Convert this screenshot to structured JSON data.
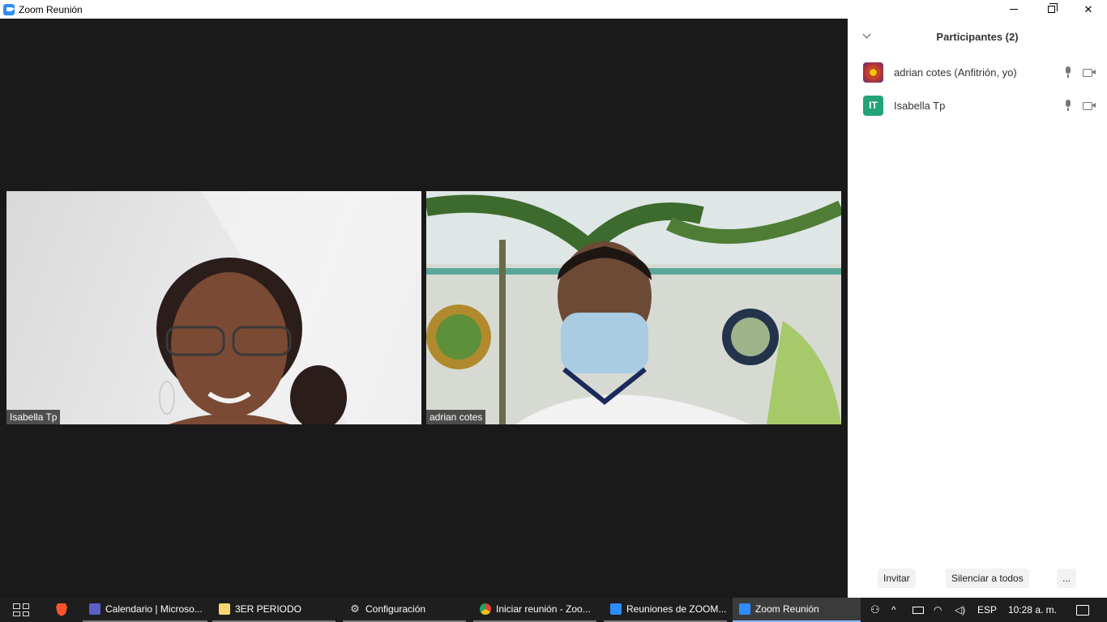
{
  "window": {
    "title": "Zoom Reunión"
  },
  "stage": {
    "tiles": [
      {
        "name": "Isabella Tp"
      },
      {
        "name": "adrian cotes"
      }
    ]
  },
  "participants_panel": {
    "header": "Participantes (2)",
    "participants": [
      {
        "name": "adrian cotes (Anfitrión, yo)",
        "avatar_text": ""
      },
      {
        "name": "Isabella Tp",
        "avatar_text": "IT"
      }
    ],
    "buttons": {
      "invite": "Invitar",
      "mute_all": "Silenciar a todos",
      "more": "..."
    }
  },
  "taskbar": {
    "items": [
      {
        "label": "Calendario | Microso...",
        "icon_color": "#5b5fc7"
      },
      {
        "label": "3ER PERIODO",
        "icon_color": "#f7d774"
      },
      {
        "label": "Configuración",
        "icon_color": "#dddddd"
      },
      {
        "label": "Iniciar reunión - Zoo...",
        "icon_color": "#e34133"
      },
      {
        "label": "Reuniones de ZOOM...",
        "icon_color": "#2d8cff"
      },
      {
        "label": "Zoom Reunión",
        "icon_color": "#2d8cff"
      }
    ],
    "tray": {
      "language": "ESP",
      "time": "10:28 a. m."
    }
  },
  "colors": {
    "stage_bg": "#1a1a1a",
    "zoom_blue": "#2d8cff",
    "avatar_it": "#23a37a"
  }
}
